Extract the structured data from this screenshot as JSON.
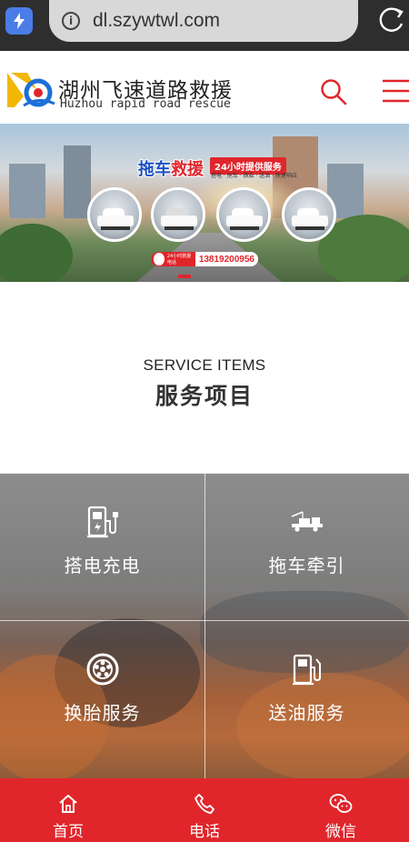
{
  "browser": {
    "url": "dl.szywtwl.com",
    "info_glyph": "i"
  },
  "header": {
    "brand_cn": "湖州飞速道路救援",
    "brand_en": "Huzhou rapid road rescue"
  },
  "banner": {
    "title_blue": "拖车",
    "title_red": "救援",
    "badge": "24小时提供服务",
    "subtitle": "搭电 · 拖车 · 换胎 · 送油 · 快速响应",
    "hotline_label": "24小时救援电话",
    "hotline_number": "13819200956"
  },
  "services": {
    "title_en": "SERVICE ITEMS",
    "title_cn": "服务项目",
    "items": [
      {
        "label": "搭电充电",
        "icon": "charging-station-icon"
      },
      {
        "label": "拖车牵引",
        "icon": "tow-truck-icon"
      },
      {
        "label": "换胎服务",
        "icon": "tire-icon"
      },
      {
        "label": "送油服务",
        "icon": "fuel-pump-icon"
      }
    ]
  },
  "bottom_nav": {
    "items": [
      {
        "label": "首页",
        "icon": "home-icon"
      },
      {
        "label": "电话",
        "icon": "phone-icon"
      },
      {
        "label": "微信",
        "icon": "wechat-icon"
      }
    ]
  },
  "colors": {
    "brand_red": "#e0262b",
    "browser_bar": "#2e2e2e"
  }
}
